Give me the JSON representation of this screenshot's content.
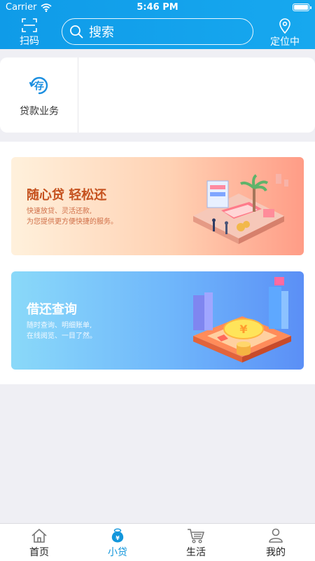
{
  "status_bar": {
    "carrier": "Carrier",
    "time": "5:46 PM"
  },
  "header": {
    "scan_label": "扫码",
    "search_placeholder": "搜索",
    "locate_label": "定位中",
    "icons": {
      "scan": "scan-icon",
      "search": "search-icon",
      "location": "location-pin-icon"
    }
  },
  "services": [
    {
      "label": "贷款业务",
      "icon_char": "存",
      "icon": "deposit-icon"
    }
  ],
  "banners": [
    {
      "title": "随心贷 轻松还",
      "subtitle_line1": "快速放贷、灵活还款,",
      "subtitle_line2": "为您提供更方便快捷的服务。"
    },
    {
      "title": "借还查询",
      "subtitle_line1": "随时查询、明细账单,",
      "subtitle_line2": "在线阅览、一目了然。"
    }
  ],
  "tabbar": {
    "active": 1,
    "tabs": [
      {
        "label": "首页",
        "icon": "home-icon"
      },
      {
        "label": "小贷",
        "icon": "money-bag-icon"
      },
      {
        "label": "生活",
        "icon": "cart-icon"
      },
      {
        "label": "我的",
        "icon": "user-icon"
      }
    ]
  },
  "colors": {
    "header": "#17a8ef",
    "active_tab": "#1296db",
    "banner_loan_title": "#c5511e"
  }
}
